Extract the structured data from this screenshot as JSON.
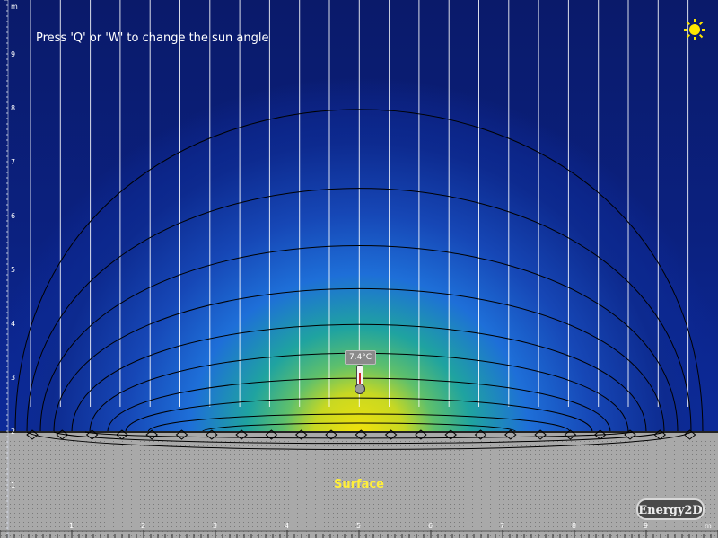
{
  "app": {
    "name": "Energy2D"
  },
  "hint": {
    "text": "Press 'Q' or 'W' to change the sun angle"
  },
  "sun": {
    "icon": "sun-icon",
    "color": "#ffe600"
  },
  "thermometer": {
    "reading": "7.4°C"
  },
  "ground": {
    "label": "Surface",
    "color": "#a9a9a9"
  },
  "axes": {
    "x_unit": "m",
    "x_ticks": [
      "1",
      "2",
      "3",
      "4",
      "5",
      "6",
      "7",
      "8",
      "9"
    ],
    "y_unit": "m",
    "y_ticks": [
      "9",
      "8",
      "7",
      "6",
      "5",
      "4",
      "3",
      "2",
      "1"
    ],
    "y_tick_below_ground": "1"
  },
  "colors": {
    "sky_top": "#0a1a6a",
    "sky_mid": "#1f6fd6",
    "warm_center": "#f3e20a",
    "teal": "#2aa89a",
    "contour": "#000000",
    "sun_rays": "#ffffff"
  }
}
